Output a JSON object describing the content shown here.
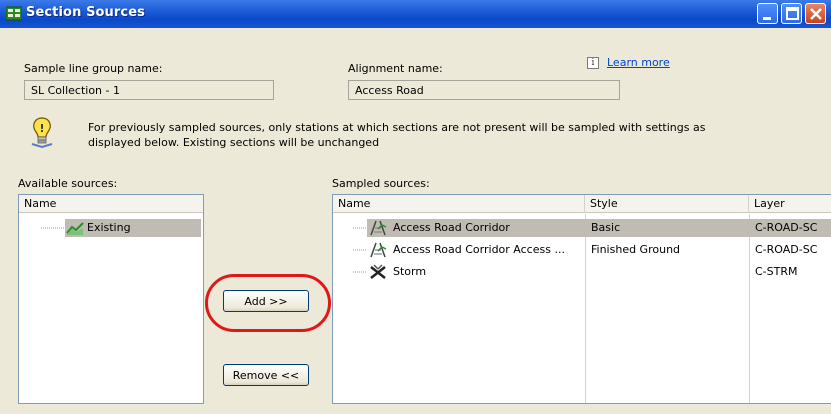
{
  "window": {
    "title": "Section Sources"
  },
  "sample_line_group": {
    "label": "Sample line group name:",
    "value": "SL Collection - 1"
  },
  "alignment": {
    "label": "Alignment name:",
    "value": "Access Road"
  },
  "learn_more": "Learn more",
  "info_message": {
    "line1": "For previously sampled sources, only stations at which sections are not present will be sampled with settings as",
    "line2": "displayed below. Existing sections will be unchanged"
  },
  "available_sources": {
    "label": "Available sources:",
    "column": "Name",
    "items": [
      {
        "name": "Existing"
      }
    ]
  },
  "sampled_sources": {
    "label": "Sampled sources:",
    "columns": {
      "name": "Name",
      "style": "Style",
      "layer": "Layer"
    },
    "rows": [
      {
        "name": "Access Road Corridor",
        "style": "Basic",
        "layer": "C-ROAD-SC"
      },
      {
        "name": "Access Road Corridor Access ...",
        "style": "Finished Ground",
        "layer": "C-ROAD-SC"
      },
      {
        "name": "Storm",
        "style": "",
        "layer": "C-STRM"
      }
    ]
  },
  "buttons": {
    "add": "Add >>",
    "remove": "Remove <<"
  },
  "icons": [
    "app-icon",
    "minimize-icon",
    "maximize-icon",
    "close-icon",
    "info-icon",
    "lightbulb-icon",
    "surface-icon",
    "corridor-icon",
    "pipe-network-icon"
  ]
}
